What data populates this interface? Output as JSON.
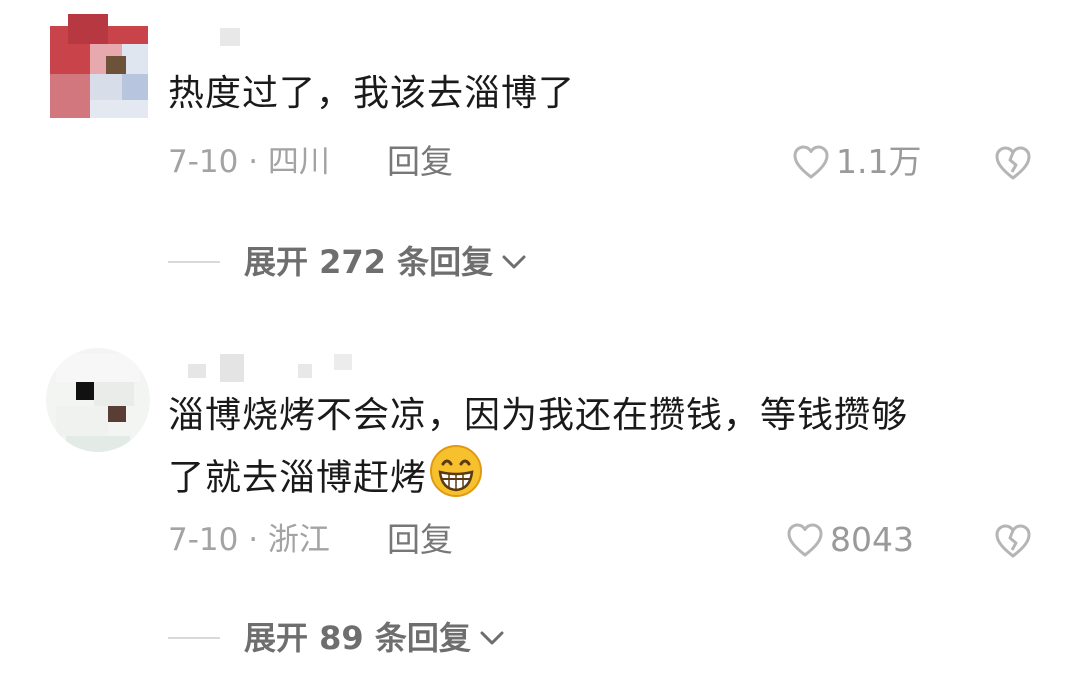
{
  "comments": [
    {
      "text": "热度过了，我该去淄博了",
      "date_location": "7-10 · 四川",
      "reply_label": "回复",
      "like_count": "1.1万",
      "expand_label": "展开 272 条回复"
    },
    {
      "text_line1": "淄博烧烤不会凉，因为我还在攒钱，等钱攒够",
      "text_line2": "了就去淄博赶烤",
      "emoji": "grinning-face-emoji",
      "date_location": "7-10 · 浙江",
      "reply_label": "回复",
      "like_count": "8043",
      "expand_label": "展开 89 条回复"
    }
  ],
  "icons": {
    "like": "heart-outline-icon",
    "dislike": "broken-heart-icon",
    "expand": "chevron-down-icon"
  },
  "colors": {
    "text": "#1a1a1a",
    "meta": "#a3a3a3",
    "reply": "#777777",
    "expand": "#6e6e6e"
  }
}
